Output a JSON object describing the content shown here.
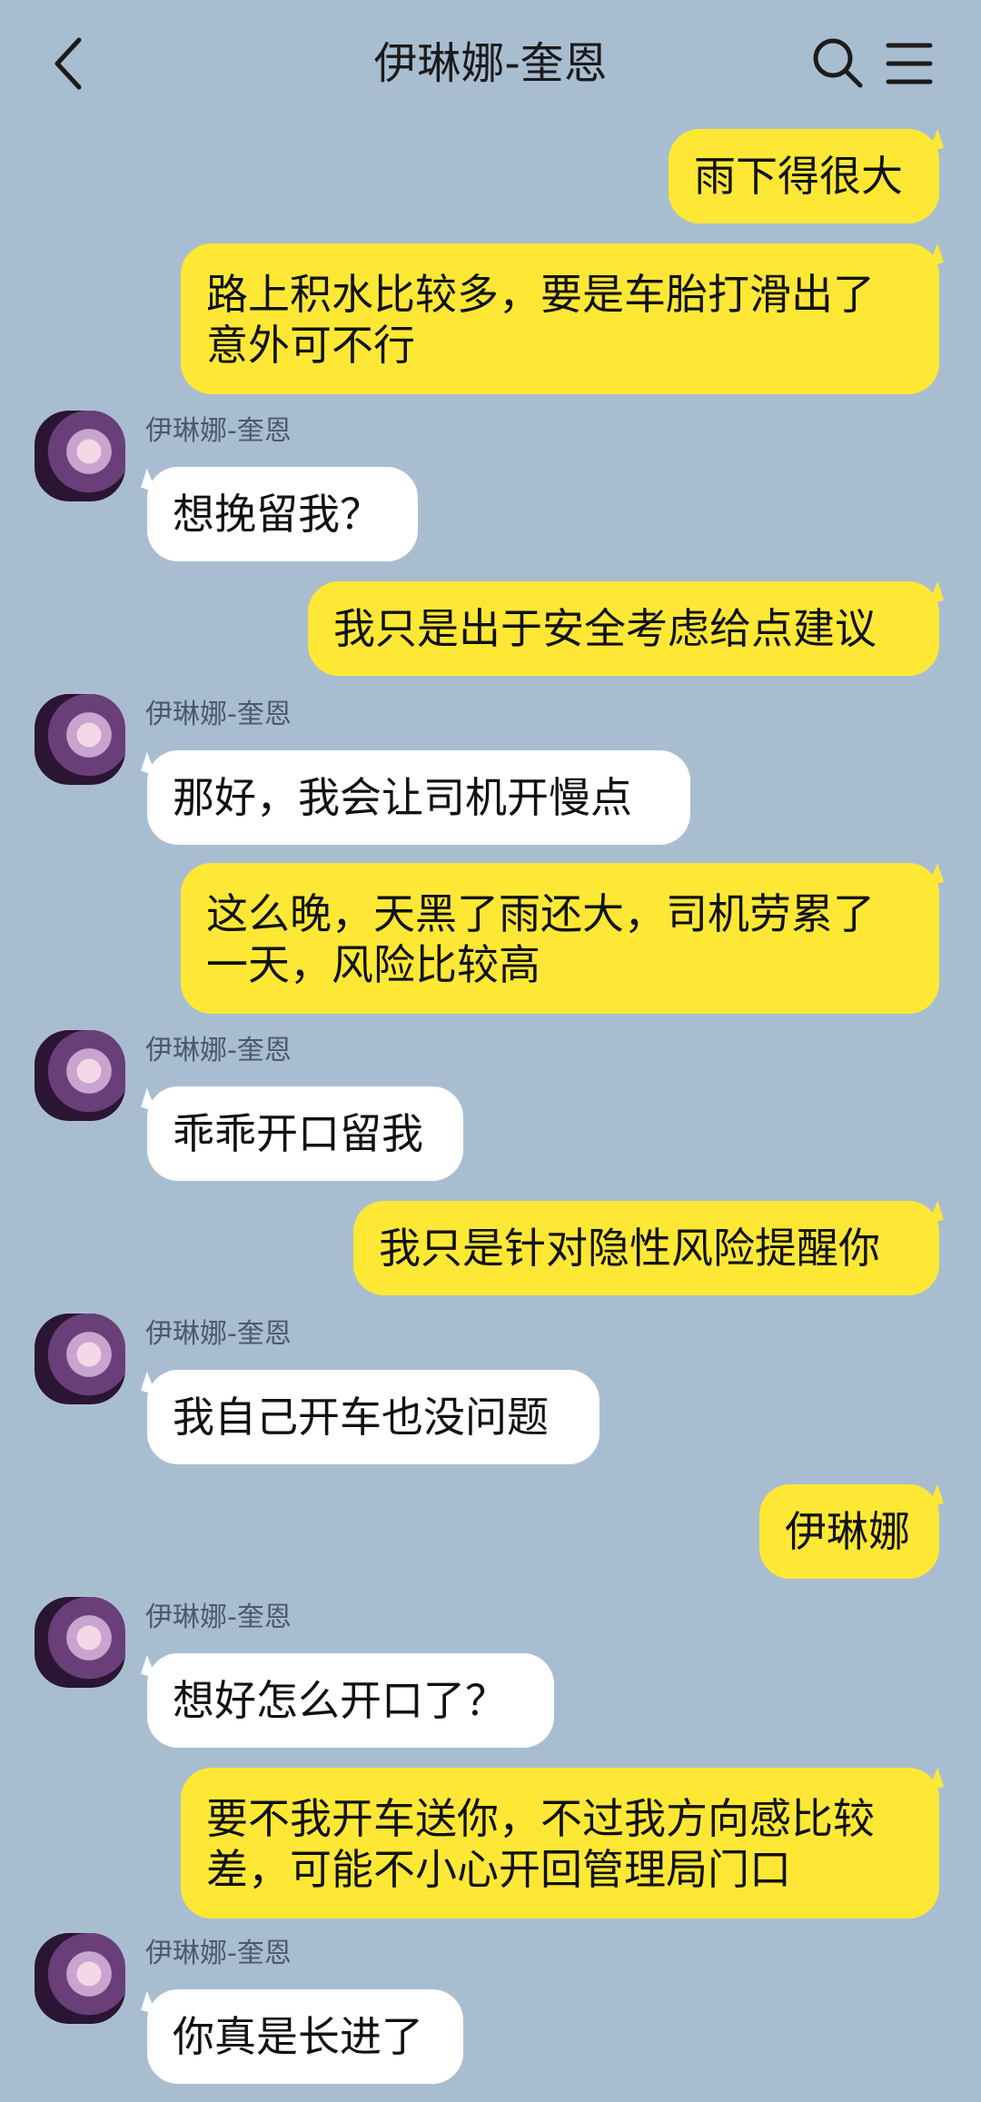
{
  "header": {
    "title": "伊琳娜-奎恩"
  },
  "icons": {
    "back": "chevron-left-icon",
    "search": "search-icon",
    "menu": "menu-icon"
  },
  "colors": {
    "background": "#a9bdd1",
    "outgoing_bubble": "#fee835",
    "incoming_bubble": "#ffffff"
  },
  "messages": [
    {
      "from": "me",
      "text": "雨下得很大"
    },
    {
      "from": "me",
      "text": "路上积水比较多，要是车胎打滑出了意外可不行"
    },
    {
      "from": "them",
      "sender": "伊琳娜-奎恩",
      "text": "想挽留我？"
    },
    {
      "from": "me",
      "text": "我只是出于安全考虑给点建议"
    },
    {
      "from": "them",
      "sender": "伊琳娜-奎恩",
      "text": "那好，我会让司机开慢点"
    },
    {
      "from": "me",
      "text": "这么晚，天黑了雨还大，司机劳累了一天，风险比较高"
    },
    {
      "from": "them",
      "sender": "伊琳娜-奎恩",
      "text": "乖乖开口留我"
    },
    {
      "from": "me",
      "text": "我只是针对隐性风险提醒你"
    },
    {
      "from": "them",
      "sender": "伊琳娜-奎恩",
      "text": "我自己开车也没问题"
    },
    {
      "from": "me",
      "text": "伊琳娜"
    },
    {
      "from": "them",
      "sender": "伊琳娜-奎恩",
      "text": "想好怎么开口了？"
    },
    {
      "from": "me",
      "text": "要不我开车送你，不过我方向感比较差，可能不小心开回管理局门口"
    },
    {
      "from": "them",
      "sender": "伊琳娜-奎恩",
      "text": "你真是长进了"
    }
  ]
}
